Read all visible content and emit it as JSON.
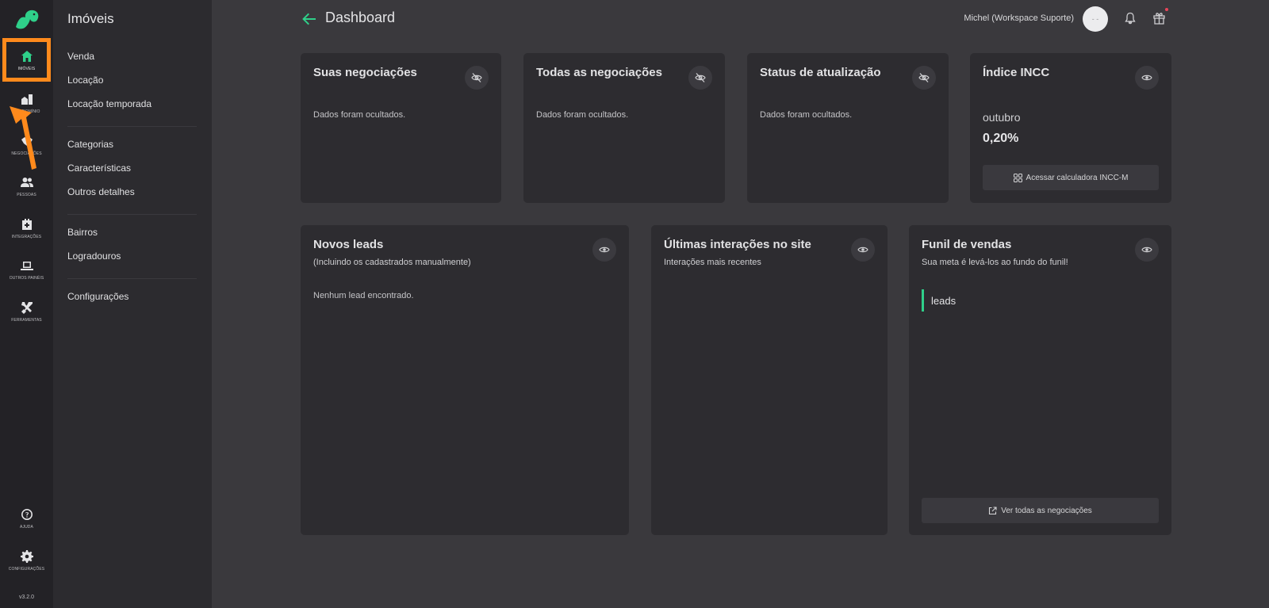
{
  "rail": {
    "items": [
      {
        "label": "Imóveis",
        "icon": "home-icon"
      },
      {
        "label": "Condomínio",
        "icon": "building-icon"
      },
      {
        "label": "Negociações",
        "icon": "handshake-icon"
      },
      {
        "label": "Pessoas",
        "icon": "people-icon"
      },
      {
        "label": "Integrações",
        "icon": "integration-icon"
      },
      {
        "label": "Outros painéis",
        "icon": "laptop-icon"
      },
      {
        "label": "Ferramentas",
        "icon": "tools-icon"
      },
      {
        "label": "Ajuda",
        "icon": "help-icon"
      },
      {
        "label": "Configurações",
        "icon": "gear-icon"
      }
    ],
    "version": "v3.2.0"
  },
  "subnav": {
    "title": "Imóveis",
    "links": [
      "Venda",
      "Locação",
      "Locação temporada",
      "Categorias",
      "Características",
      "Outros detalhes",
      "Bairros",
      "Logradouros",
      "Configurações"
    ]
  },
  "header": {
    "title": "Dashboard",
    "user": "Michel (Workspace Suporte)",
    "avatar_text": "- -"
  },
  "cards": {
    "suas_negociacoes": {
      "title": "Suas negociações",
      "body": "Dados foram ocultados."
    },
    "todas_negociacoes": {
      "title": "Todas as negociações",
      "body": "Dados foram ocultados."
    },
    "status_atualizacao": {
      "title": "Status de atualização",
      "body": "Dados foram ocultados."
    },
    "incc": {
      "title": "Índice INCC",
      "month": "outubro",
      "value": "0,20%",
      "button": "Acessar calculadora INCC-M"
    },
    "novos_leads": {
      "title": "Novos leads",
      "subtitle": "(Incluindo os cadastrados manualmente)",
      "body": "Nenhum lead encontrado."
    },
    "interacoes": {
      "title": "Últimas interações no site",
      "subtitle": "Interações mais recentes"
    },
    "funil": {
      "title": "Funil de vendas",
      "subtitle": "Sua meta é levá-los ao fundo do funil!",
      "stage": "leads",
      "button": "Ver todas as negociações"
    }
  },
  "colors": {
    "accent": "#2fd08a",
    "highlight": "#ff8a1c",
    "card": "#2d2c30",
    "background": "#3a393d"
  }
}
